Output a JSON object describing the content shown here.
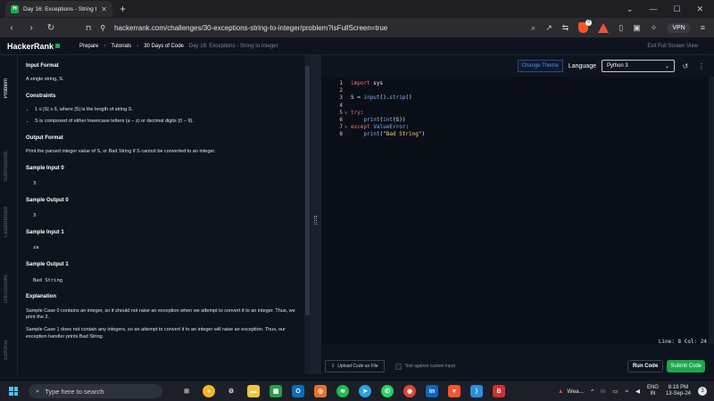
{
  "browser": {
    "tab_title": "Day 16: Exceptions - String to I",
    "tab_favicon": "H",
    "url": "hackerrank.com/challenges/30-exceptions-string-to-integer/problem?isFullScreen=true",
    "vpn_label": "VPN",
    "shield_count": "0",
    "alert_count": "1"
  },
  "header": {
    "logo": "HackerRank",
    "crumbs": [
      "Prepare",
      "Tutorials",
      "30 Days of Code"
    ],
    "current": "Day 16: Exceptions - String to Integer",
    "exit_fullscreen": "Exit Full Screen View"
  },
  "sidenav": [
    "Problem",
    "Submissions",
    "Leaderboard",
    "Discussions",
    "Editorial"
  ],
  "problem": {
    "input_format_title": "Input Format",
    "input_format_text": "A single string, S.",
    "constraints_title": "Constraints",
    "constraints": [
      "1 ≤ |S| ≤ 6, where |S| is the length of string S.",
      "S is composed of either lowercase letters (a − z) or decimal digits (0 − 9)."
    ],
    "output_format_title": "Output Format",
    "output_format_text": "Print the parsed integer value of S, or Bad String if S cannot be converted to an integer.",
    "sample_input_0_title": "Sample Input 0",
    "sample_input_0": "3",
    "sample_output_0_title": "Sample Output 0",
    "sample_output_0": "3",
    "sample_input_1_title": "Sample Input 1",
    "sample_input_1": "za",
    "sample_output_1_title": "Sample Output 1",
    "sample_output_1": "Bad String",
    "explanation_title": "Explanation",
    "explanation_1": "Sample Case 0 contains an integer, so it should not raise an exception when we attempt to convert it to an integer. Thus, we print the 3.",
    "explanation_2": "Sample Case 1 does not contain any integers, so an attempt to convert it to an integer will raise an exception. Thus, our exception handler prints Bad String."
  },
  "editor": {
    "change_theme": "Change Theme",
    "language_label": "Language",
    "language": "Python 3",
    "lines": [
      {
        "n": "1",
        "fold": "",
        "html": "<span class='kw'>import</span> sys"
      },
      {
        "n": "2",
        "fold": "",
        "html": ""
      },
      {
        "n": "3",
        "fold": "",
        "html": "S = <span class='fn'>input</span>().<span class='fn'>strip</span>()"
      },
      {
        "n": "4",
        "fold": "",
        "html": ""
      },
      {
        "n": "5",
        "fold": "v",
        "html": "<span class='kw'>try</span>:"
      },
      {
        "n": "6",
        "fold": "",
        "html": "    <span class='fn'>print</span>(<span class='fn'>int</span>(S))"
      },
      {
        "n": "7",
        "fold": "v",
        "html": "<span class='kw'>except</span> <span class='ex'>ValueError</span>:"
      },
      {
        "n": "8",
        "fold": "",
        "html": "    <span class='fn'>print</span>(<span class='str'>\"Bad String\"</span>)"
      }
    ],
    "status": "Line: 8 Col: 24",
    "upload_label": "Upload Code as File",
    "custom_input_label": "Test against custom input",
    "run_label": "Run Code",
    "submit_label": "Submit Code"
  },
  "taskbar": {
    "search_placeholder": "Type here to search",
    "weather": "Wea...",
    "lang_top": "ENG",
    "lang_bottom": "IN",
    "time": "8:19 PM",
    "date": "13-Sep-24",
    "notif": "3"
  }
}
